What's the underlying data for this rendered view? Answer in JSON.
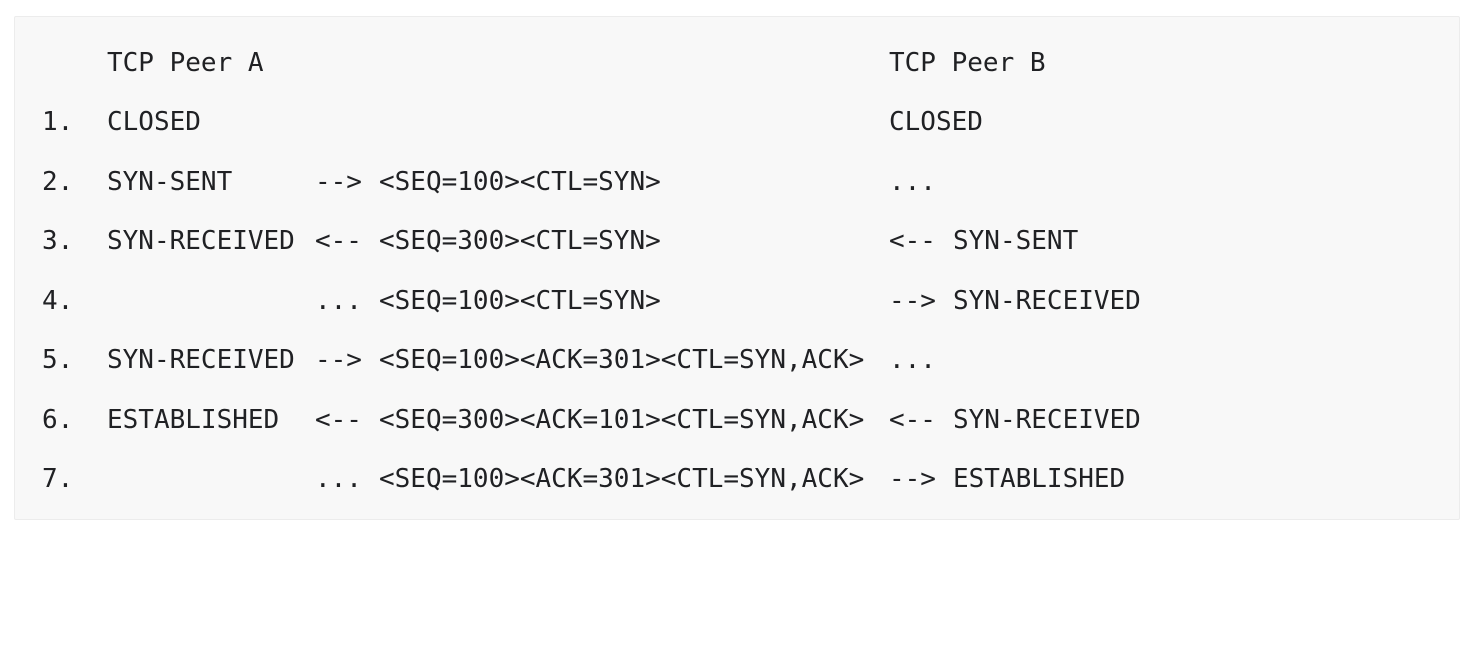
{
  "header": {
    "peer_a": "TCP Peer A",
    "peer_b": "TCP Peer B"
  },
  "rows": [
    {
      "num": "1.",
      "a_state": "CLOSED",
      "a_arrow": "",
      "segment": "",
      "b_arrow": "",
      "b_state": "CLOSED"
    },
    {
      "num": "2.",
      "a_state": "SYN-SENT",
      "a_arrow": "-->",
      "segment": "<SEQ=100><CTL=SYN>",
      "b_arrow": "...",
      "b_state": ""
    },
    {
      "num": "3.",
      "a_state": "SYN-RECEIVED",
      "a_arrow": "<--",
      "segment": "<SEQ=300><CTL=SYN>",
      "b_arrow": "<--",
      "b_state": "SYN-SENT"
    },
    {
      "num": "4.",
      "a_state": "",
      "a_arrow": "...",
      "segment": "<SEQ=100><CTL=SYN>",
      "b_arrow": "-->",
      "b_state": "SYN-RECEIVED"
    },
    {
      "num": "5.",
      "a_state": "SYN-RECEIVED",
      "a_arrow": "-->",
      "segment": "<SEQ=100><ACK=301><CTL=SYN,ACK>",
      "b_arrow": "...",
      "b_state": ""
    },
    {
      "num": "6.",
      "a_state": "ESTABLISHED",
      "a_arrow": "<--",
      "segment": "<SEQ=300><ACK=101><CTL=SYN,ACK>",
      "b_arrow": "<--",
      "b_state": "SYN-RECEIVED"
    },
    {
      "num": "7.",
      "a_state": "",
      "a_arrow": "...",
      "segment": "<SEQ=100><ACK=301><CTL=SYN,ACK>",
      "b_arrow": "-->",
      "b_state": "ESTABLISHED"
    }
  ]
}
